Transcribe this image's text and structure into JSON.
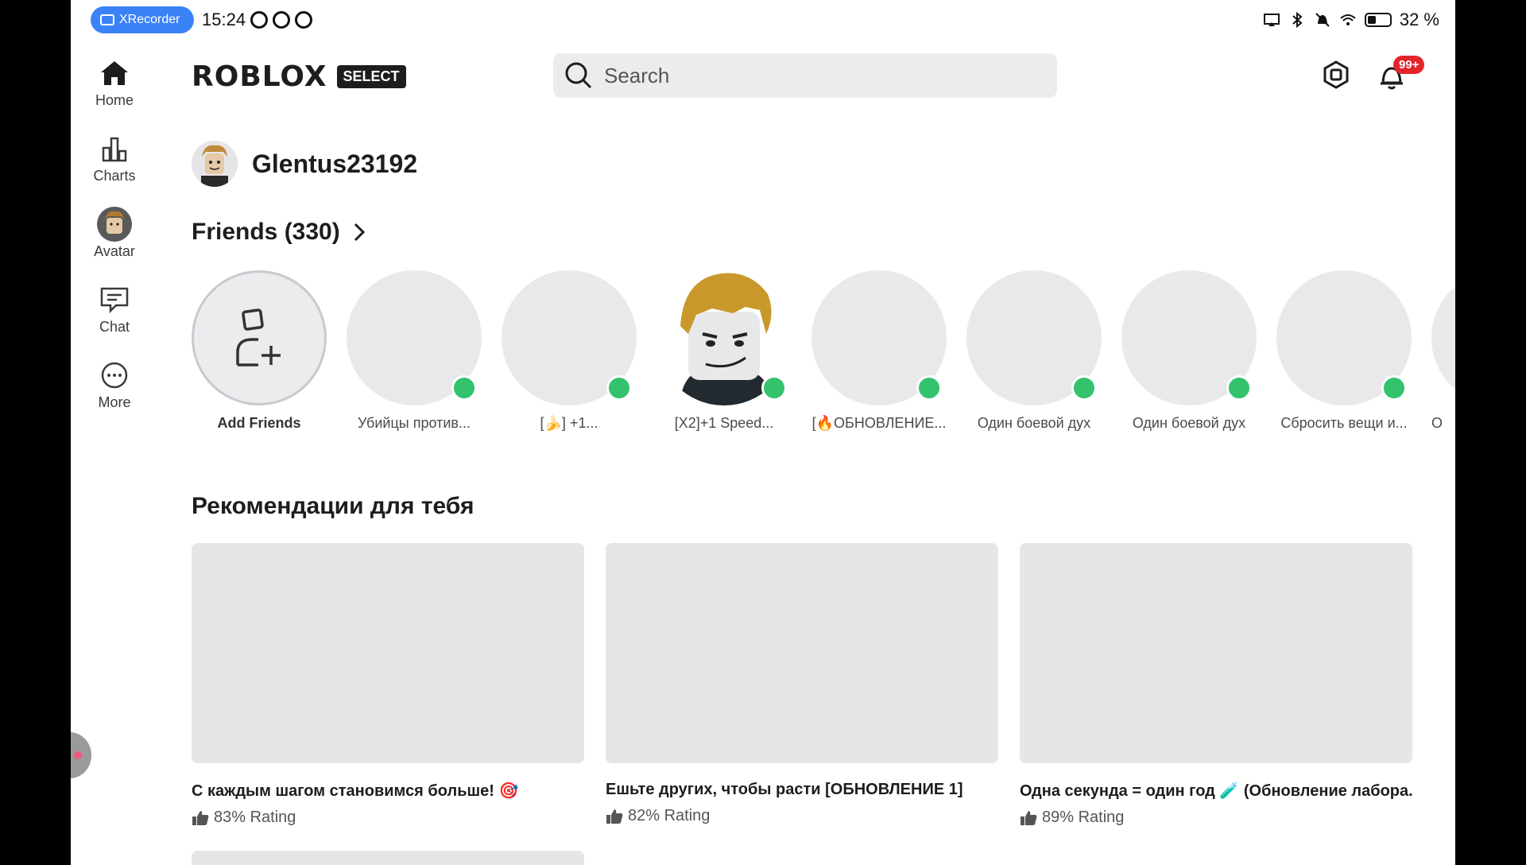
{
  "status_bar": {
    "recorder_label": "XRecorder",
    "time": "15:24",
    "battery": "32 %"
  },
  "sidebar": {
    "items": [
      {
        "label": "Home",
        "icon": "home-icon"
      },
      {
        "label": "Charts",
        "icon": "charts-icon"
      },
      {
        "label": "Avatar",
        "icon": "avatar-icon"
      },
      {
        "label": "Chat",
        "icon": "chat-icon"
      },
      {
        "label": "More",
        "icon": "more-icon"
      }
    ]
  },
  "header": {
    "logo_text": "ROBLOX",
    "logo_badge": "SELECT",
    "search_placeholder": "Search",
    "notification_count": "99+"
  },
  "profile": {
    "username": "Glentus23192"
  },
  "friends": {
    "title": "Friends (330)",
    "add_label": "Add Friends",
    "items": [
      {
        "name": "Убийцы против...",
        "online": true
      },
      {
        "name": "[🍌] +1...",
        "online": true
      },
      {
        "name": "[X2]+1 Speed...",
        "online": true
      },
      {
        "name": "[🔥ОБНОВЛЕНИЕ...",
        "online": true
      },
      {
        "name": "Один боевой дух",
        "online": true
      },
      {
        "name": "Один боевой дух",
        "online": true
      },
      {
        "name": "Сбросить вещи и...",
        "online": true
      },
      {
        "name": "О",
        "online": false
      }
    ]
  },
  "recommendations": {
    "title": "Рекомендации для тебя",
    "games": [
      {
        "name": "С каждым шагом становимся больше! 🎯",
        "rating": "83% Rating"
      },
      {
        "name": "Ешьте других, чтобы расти [ОБНОВЛЕНИЕ 1]",
        "rating": "82% Rating"
      },
      {
        "name": "Одна секунда = один год 🧪 (Обновление лабора...",
        "rating": "89% Rating"
      }
    ]
  },
  "colors": {
    "online": "#32c36c",
    "badge": "#e4242b",
    "recorder": "#3b82f6"
  }
}
